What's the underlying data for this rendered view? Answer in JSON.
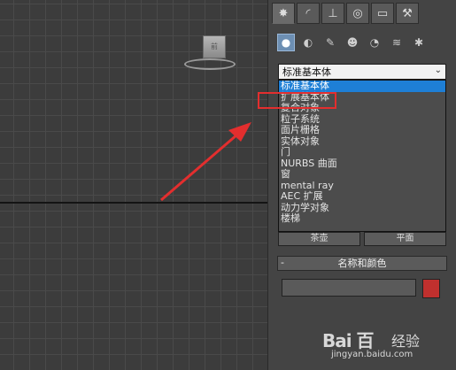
{
  "viewcube": {
    "label": "前"
  },
  "command_tabs": [
    {
      "icon": "create-icon-star",
      "glyph": "✸"
    },
    {
      "icon": "modify-icon",
      "glyph": "◜"
    },
    {
      "icon": "hierarchy-icon",
      "glyph": "⊥"
    },
    {
      "icon": "motion-icon",
      "glyph": "◎"
    },
    {
      "icon": "display-icon",
      "glyph": "▭"
    },
    {
      "icon": "utilities-icon",
      "glyph": "⚒"
    }
  ],
  "create_icons": [
    {
      "icon": "geometry-icon",
      "glyph": "●"
    },
    {
      "icon": "shapes-icon",
      "glyph": "◐"
    },
    {
      "icon": "lights-icon",
      "glyph": "✎"
    },
    {
      "icon": "cameras-icon",
      "glyph": "☻"
    },
    {
      "icon": "helpers-icon",
      "glyph": "◔"
    },
    {
      "icon": "space-warps-icon",
      "glyph": "≋"
    },
    {
      "icon": "systems-icon",
      "glyph": "✱"
    }
  ],
  "category": {
    "selected": "标准基本体",
    "chevron": "⌄"
  },
  "dropdown_items": [
    "标准基本体",
    "扩展基本体",
    "复合对象",
    "粒子系统",
    "面片栅格",
    "实体对象",
    "门",
    "NURBS 曲面",
    "窗",
    "mental ray",
    "AEC 扩展",
    "动力学对象",
    "楼梯"
  ],
  "object_buttons": {
    "left": "茶壶",
    "right": "平面"
  },
  "name_rollout": {
    "collapse": "-",
    "title": "名称和颜色",
    "name_value": ""
  },
  "colors": {
    "swatch": "#c0302e",
    "highlight": "#1e7fd6",
    "annotation": "#e32e2e"
  },
  "watermark": {
    "logo": "Bai 百",
    "text": "经验",
    "url": "jingyan.baidu.com"
  }
}
